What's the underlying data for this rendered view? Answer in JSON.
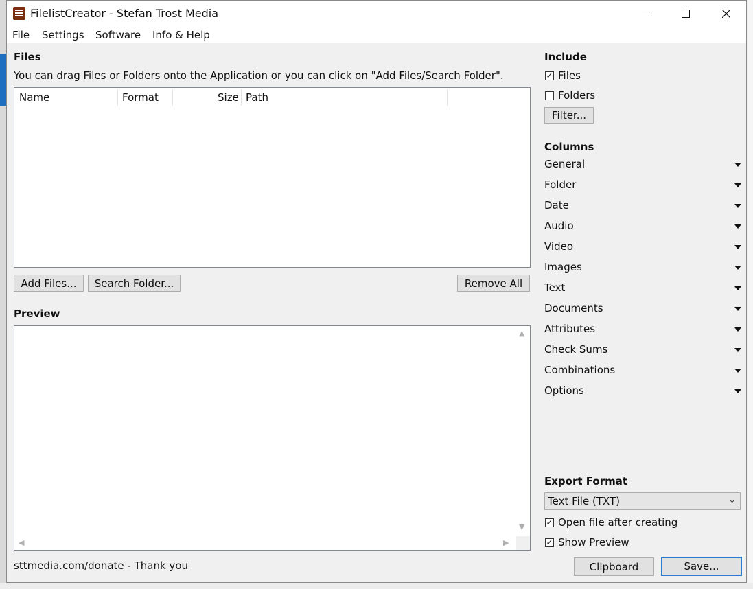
{
  "window": {
    "title": "FilelistCreator - Stefan Trost Media",
    "controls": {
      "minimize": "minimize",
      "maximize": "maximize",
      "close": "close"
    }
  },
  "menu": [
    "File",
    "Settings",
    "Software",
    "Info & Help"
  ],
  "files": {
    "title": "Files",
    "hint": "You can drag Files or Folders onto the Application or you can click on \"Add Files/Search Folder\".",
    "columns": [
      "Name",
      "Format",
      "Size",
      "Path"
    ],
    "add_files": "Add Files...",
    "search_folder": "Search Folder...",
    "remove_all": "Remove All"
  },
  "preview": {
    "title": "Preview"
  },
  "include": {
    "title": "Include",
    "files_label": "Files",
    "files_checked": true,
    "folders_label": "Folders",
    "folders_checked": false,
    "filter": "Filter..."
  },
  "columns_panel": {
    "title": "Columns",
    "items": [
      "General",
      "Folder",
      "Date",
      "Audio",
      "Video",
      "Images",
      "Text",
      "Documents",
      "Attributes",
      "Check Sums",
      "Combinations",
      "Options"
    ]
  },
  "export": {
    "title": "Export Format",
    "format": "Text File (TXT)",
    "open_after_label": "Open file after creating",
    "open_after_checked": true,
    "show_preview_label": "Show Preview",
    "show_preview_checked": true
  },
  "footer": {
    "donate": "sttmedia.com/donate - Thank you",
    "clipboard": "Clipboard",
    "save": "Save..."
  },
  "colors": {
    "default_button_border": "#2b7bd3",
    "app_icon": "#7a2f10"
  }
}
